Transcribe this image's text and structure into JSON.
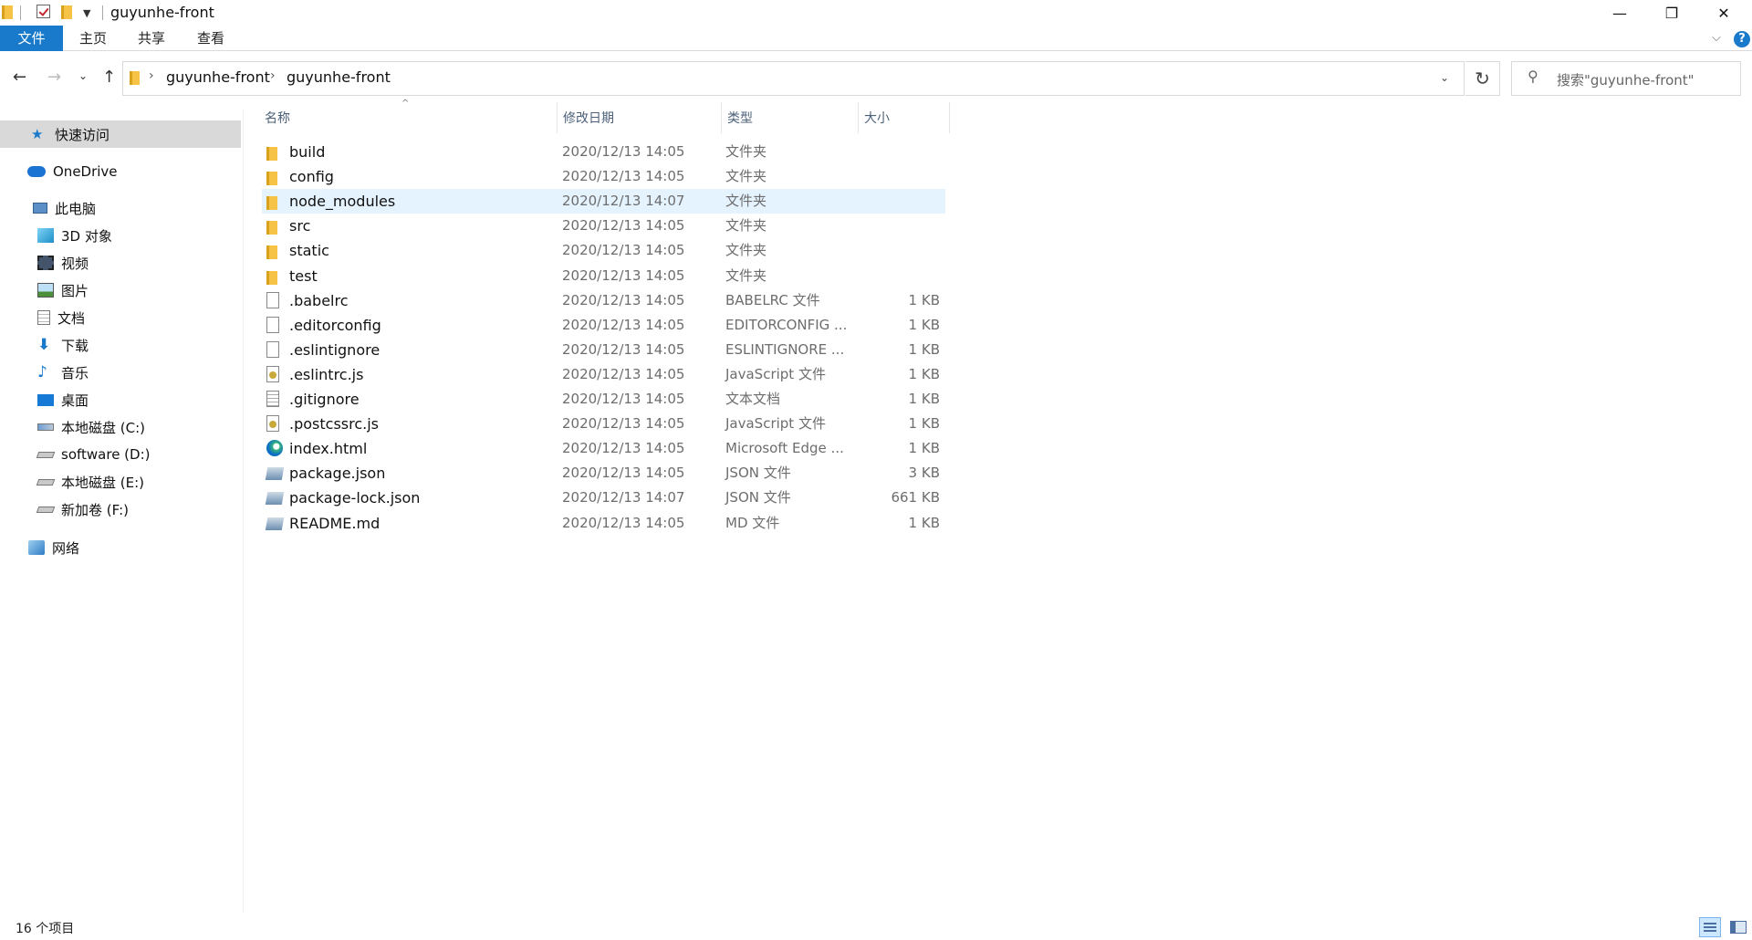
{
  "window": {
    "title": "guyunhe-front",
    "minimize_glyph": "—",
    "maximize_glyph": "❐",
    "close_glyph": "✕"
  },
  "ribbon": {
    "tabs": [
      "文件",
      "主页",
      "共享",
      "查看"
    ],
    "chevron_glyph": "⌵",
    "help_glyph": "?"
  },
  "navigation": {
    "back_glyph": "←",
    "forward_glyph": "→",
    "recent_glyph": "⌄",
    "up_glyph": "↑",
    "breadcrumb": [
      "guyunhe-front",
      "guyunhe-front"
    ],
    "separator_glyph": "›",
    "dropdown_glyph": "⌄",
    "refresh_glyph": "↻",
    "search_placeholder": "搜索\"guyunhe-front\""
  },
  "sidebar": {
    "items": [
      {
        "label": "快速访问",
        "icon": "star-icon"
      },
      {
        "label": "OneDrive",
        "icon": "cloud-icon"
      },
      {
        "label": "此电脑",
        "icon": "computer-icon"
      },
      {
        "label": "3D 对象",
        "icon": "cube-icon"
      },
      {
        "label": "视频",
        "icon": "video-icon"
      },
      {
        "label": "图片",
        "icon": "picture-icon"
      },
      {
        "label": "文档",
        "icon": "document-icon"
      },
      {
        "label": "下载",
        "icon": "download-icon"
      },
      {
        "label": "音乐",
        "icon": "music-icon"
      },
      {
        "label": "桌面",
        "icon": "desktop-icon"
      },
      {
        "label": "本地磁盘 (C:)",
        "icon": "drive-c-icon"
      },
      {
        "label": "software (D:)",
        "icon": "drive-icon"
      },
      {
        "label": "本地磁盘 (E:)",
        "icon": "drive-icon"
      },
      {
        "label": "新加卷 (F:)",
        "icon": "drive-icon"
      },
      {
        "label": "网络",
        "icon": "network-icon"
      }
    ]
  },
  "columns": {
    "name": "名称",
    "date": "修改日期",
    "type": "类型",
    "size": "大小",
    "sort_glyph": "^"
  },
  "files": [
    {
      "name": "build",
      "date": "2020/12/13 14:05",
      "type": "文件夹",
      "size": "",
      "icon": "folder-icon"
    },
    {
      "name": "config",
      "date": "2020/12/13 14:05",
      "type": "文件夹",
      "size": "",
      "icon": "folder-icon"
    },
    {
      "name": "node_modules",
      "date": "2020/12/13 14:07",
      "type": "文件夹",
      "size": "",
      "icon": "folder-icon"
    },
    {
      "name": "src",
      "date": "2020/12/13 14:05",
      "type": "文件夹",
      "size": "",
      "icon": "folder-icon"
    },
    {
      "name": "static",
      "date": "2020/12/13 14:05",
      "type": "文件夹",
      "size": "",
      "icon": "folder-icon"
    },
    {
      "name": "test",
      "date": "2020/12/13 14:05",
      "type": "文件夹",
      "size": "",
      "icon": "folder-icon"
    },
    {
      "name": ".babelrc",
      "date": "2020/12/13 14:05",
      "type": "BABELRC 文件",
      "size": "1 KB",
      "icon": "file-icon"
    },
    {
      "name": ".editorconfig",
      "date": "2020/12/13 14:05",
      "type": "EDITORCONFIG ...",
      "size": "1 KB",
      "icon": "file-icon"
    },
    {
      "name": ".eslintignore",
      "date": "2020/12/13 14:05",
      "type": "ESLINTIGNORE ...",
      "size": "1 KB",
      "icon": "file-icon"
    },
    {
      "name": ".eslintrc.js",
      "date": "2020/12/13 14:05",
      "type": "JavaScript 文件",
      "size": "1 KB",
      "icon": "js-file-icon"
    },
    {
      "name": ".gitignore",
      "date": "2020/12/13 14:05",
      "type": "文本文档",
      "size": "1 KB",
      "icon": "text-file-icon"
    },
    {
      "name": ".postcssrc.js",
      "date": "2020/12/13 14:05",
      "type": "JavaScript 文件",
      "size": "1 KB",
      "icon": "js-file-icon"
    },
    {
      "name": "index.html",
      "date": "2020/12/13 14:05",
      "type": "Microsoft Edge ...",
      "size": "1 KB",
      "icon": "edge-icon"
    },
    {
      "name": "package.json",
      "date": "2020/12/13 14:05",
      "type": "JSON 文件",
      "size": "3 KB",
      "icon": "json-file-icon"
    },
    {
      "name": "package-lock.json",
      "date": "2020/12/13 14:07",
      "type": "JSON 文件",
      "size": "661 KB",
      "icon": "json-file-icon"
    },
    {
      "name": "README.md",
      "date": "2020/12/13 14:05",
      "type": "MD 文件",
      "size": "1 KB",
      "icon": "json-file-icon"
    }
  ],
  "selected_file": "node_modules",
  "status": {
    "item_count": "16 个项目"
  },
  "colors": {
    "accent": "#1979ca",
    "selection": "#e5f3ff",
    "folder": "#f6c347"
  }
}
